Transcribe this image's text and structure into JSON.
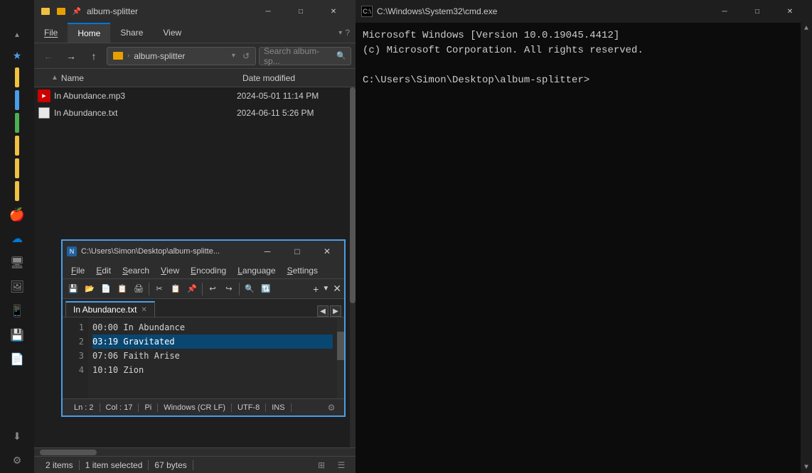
{
  "file_explorer": {
    "titlebar": {
      "title": "album-splitter",
      "minimize_label": "─",
      "maximize_label": "□",
      "close_label": "✕"
    },
    "ribbon": {
      "tabs": [
        "File",
        "Home",
        "Share",
        "View"
      ],
      "active_tab": "Home",
      "more_label": "▾",
      "help_label": "?"
    },
    "address": {
      "path_icon": "folder",
      "separator": "›",
      "path_text": "album-splitter",
      "search_placeholder": "Search album-sp...",
      "search_icon": "🔍"
    },
    "columns": {
      "name": "Name",
      "date_modified": "Date modified"
    },
    "files": [
      {
        "name": "In Abundance.mp3",
        "type": "mp3",
        "date": "2024-05-01 11:14 PM",
        "selected": false
      },
      {
        "name": "In Abundance.txt",
        "type": "txt",
        "date": "2024-06-11 5:26 PM",
        "selected": false
      }
    ],
    "status": {
      "items_count": "2 items",
      "selected": "1 item selected",
      "size": "67 bytes"
    }
  },
  "notepad": {
    "titlebar": {
      "title": "C:\\Users\\Simon\\Desktop\\album-splitte...",
      "minimize_label": "─",
      "maximize_label": "□",
      "close_label": "✕"
    },
    "menubar": {
      "items": [
        "File",
        "Edit",
        "Search",
        "View",
        "Encoding",
        "Language",
        "Settings"
      ]
    },
    "toolbar": {
      "plus_label": "+",
      "arrow_label": "▼",
      "x_label": "✕"
    },
    "tab": {
      "label": "In Abundance.txt",
      "close_label": "✕",
      "active": true
    },
    "lines": [
      {
        "num": 1,
        "text": "00:00 In Abundance",
        "highlighted": false
      },
      {
        "num": 2,
        "text": "03:19 Gravitated",
        "highlighted": true
      },
      {
        "num": 3,
        "text": "07:06 Faith Arise",
        "highlighted": false
      },
      {
        "num": 4,
        "text": "10:10 Zion",
        "highlighted": false
      }
    ],
    "statusbar": {
      "ln": "Ln : 2",
      "col": "Col : 17",
      "pi": "Pi",
      "encoding": "Windows (CR LF)",
      "charset": "UTF-8",
      "mode": "INS"
    }
  },
  "cmd": {
    "titlebar": {
      "title": "C:\\Windows\\System32\\cmd.exe",
      "minimize_label": "─",
      "maximize_label": "□",
      "close_label": "✕"
    },
    "content": {
      "line1": "Microsoft Windows [Version 10.0.19045.4412]",
      "line2": "(c) Microsoft Corporation. All rights reserved.",
      "line3": "",
      "line4": "C:\\Users\\Simon\\Desktop\\album-splitter>"
    }
  },
  "sidebar": {
    "icons": [
      "◀",
      "▶",
      "↑",
      "📁",
      "★",
      "⬇",
      "🔵",
      "☁",
      "💻",
      "🖼",
      "📱",
      "💾",
      "📄"
    ]
  }
}
